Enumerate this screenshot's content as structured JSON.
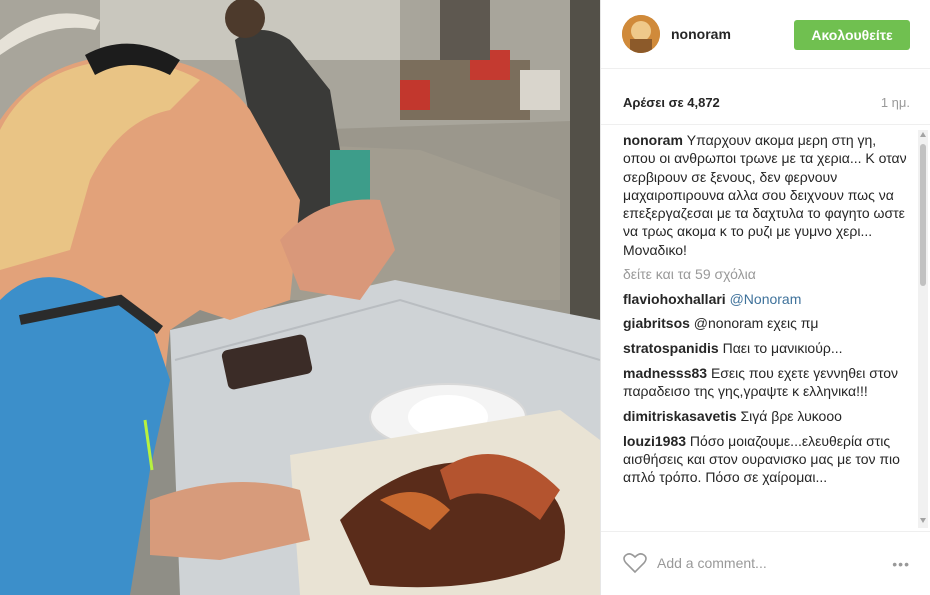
{
  "post": {
    "username": "nonoram",
    "follow_label": "Ακολουθείτε",
    "likes": "Αρέσει σε 4,872",
    "time": "1 ημ.",
    "caption_text": "Υπαρχουν ακομα μερη στη γη, οπου οι ανθρωποι τρωνε με τα χερια... Κ οταν σερβιρουν σε ξενους, δεν φερνουν μαχαιροπιρουνα αλλα σου δειχνουν πως να επεξεργαζεσαι με τα δαχτυλα το φαγητο ωστε να τρως ακομα κ το ρυζι με γυμνο χερι... Μοναδικο!",
    "view_all": "δείτε και τα 59 σχόλια",
    "add_comment_placeholder": "Add a comment...",
    "more_icon": "more-options-icon",
    "like_icon": "heart-icon"
  },
  "comments": [
    {
      "user": "flaviohoxhallari",
      "text": "@Nonoram"
    },
    {
      "user": "giabritsos",
      "text": "@nonoram εχεις πμ"
    },
    {
      "user": "stratospanidis",
      "text": "Παει το μανικιούρ... "
    },
    {
      "user": "madnesss83",
      "text": "Εσεις που εχετε γεννηθει στον παραδεισο της γης,γραψτε κ ελληνικα!!!"
    },
    {
      "user": "dimitriskasavetis",
      "text": "Σιγά βρε λυκοοο"
    },
    {
      "user": "louzi1983",
      "text": "Πόσο μοιαζουμε...ελευθερία στις αισθήσεις και στον ουρανισκο μας με τον πιο απλό τρόπο. Πόσο σε χαίρομαι..."
    }
  ],
  "colors": {
    "follow": "#70c050",
    "mention": "#3f729b",
    "muted": "#999999"
  }
}
